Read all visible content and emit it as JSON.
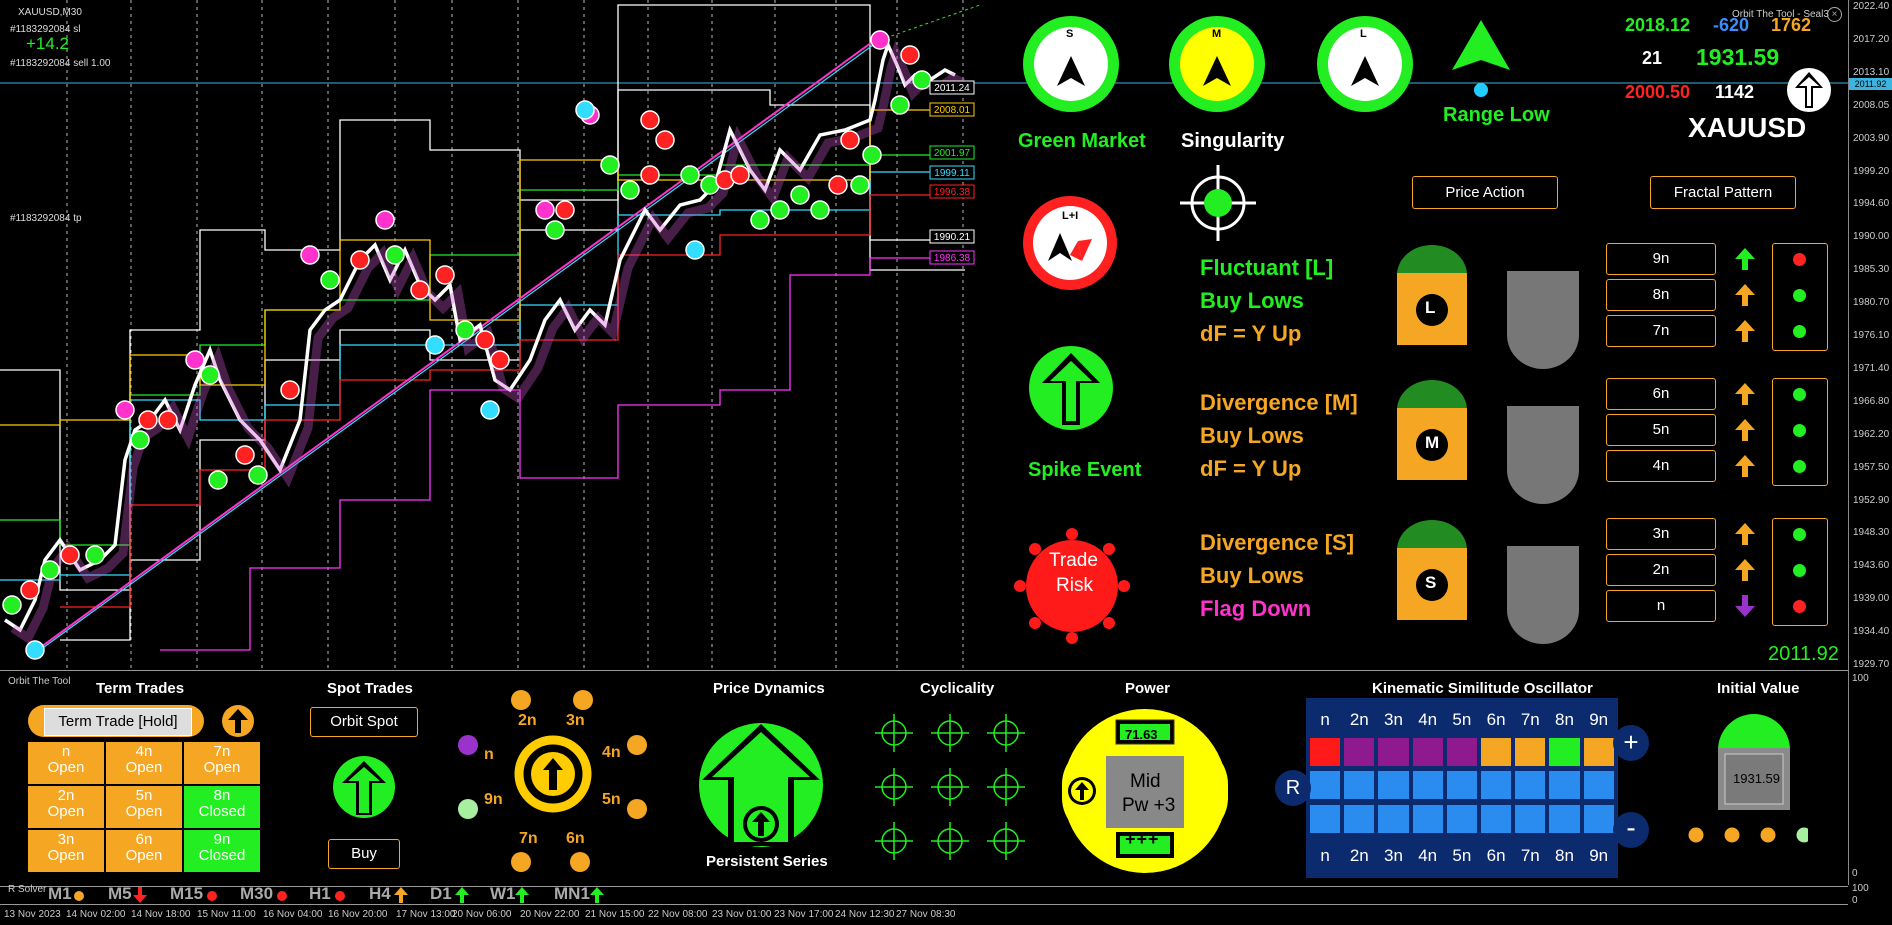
{
  "window": {
    "symbol_tf": "XAUUSD,M30",
    "app_title": "Orbit The Tool - Seal3",
    "subwindow_title": "Orbit The Tool",
    "subwindow2_title": "R Solver"
  },
  "chart": {
    "order_sl": "#1183292084 sl",
    "pnl": "+14.2",
    "order_sell": "#1183292084 sell 1.00",
    "order_tp": "#1183292084 tp",
    "price_axis": [
      "2022.40",
      "2017.20",
      "2013.10",
      "2008.05",
      "2003.90",
      "1999.20",
      "1994.60",
      "1990.00",
      "1985.30",
      "1980.70",
      "1976.10",
      "1971.40",
      "1966.80",
      "1962.20",
      "1957.50",
      "1952.90",
      "1948.30",
      "1943.60",
      "1939.00",
      "1934.40",
      "1929.70"
    ],
    "current_price_tag": "2011.92",
    "level_tags": [
      {
        "label": "2011.24",
        "color": "#ffffff"
      },
      {
        "label": "2008.01",
        "color": "#ffcc00"
      },
      {
        "label": "2001.97",
        "color": "#22ee22"
      },
      {
        "label": "1999.11",
        "color": "#33ddff"
      },
      {
        "label": "1996.38",
        "color": "#ff2222"
      },
      {
        "label": "1990.21",
        "color": "#ffffff"
      },
      {
        "label": "1986.38",
        "color": "#ff33ff"
      }
    ],
    "time_axis": [
      "13 Nov 2023",
      "14 Nov 02:00",
      "14 Nov 18:00",
      "15 Nov 11:00",
      "16 Nov 04:00",
      "16 Nov 20:00",
      "17 Nov 13:00",
      "20 Nov 06:00",
      "20 Nov 22:00",
      "21 Nov 15:00",
      "22 Nov 08:00",
      "23 Nov 01:00",
      "23 Nov 17:00",
      "24 Nov 12:30",
      "27 Nov 08:30"
    ],
    "sub_axis": [
      "100",
      "0",
      "100",
      "0"
    ]
  },
  "dashboard": {
    "compass": [
      {
        "letter": "S",
        "label": "Green Market",
        "ring": "#22ee22",
        "fill": "#ffffff"
      },
      {
        "letter": "M",
        "label": "Singularity",
        "ring": "#22ee22",
        "fill": "#ffff00"
      },
      {
        "letter": "L",
        "label": "",
        "ring": "#22ee22",
        "fill": "#ffffff"
      }
    ],
    "range_label": "Range Low",
    "lplus_letter": "L+I",
    "spike_label": "Spike Event",
    "trade_risk_1": "Trade",
    "trade_risk_2": "Risk",
    "stats": {
      "v1": "2018.12",
      "v2": "-620",
      "v3": "1762",
      "v4": "21",
      "v5": "1931.59",
      "v6": "2000.50",
      "v7": "1142"
    },
    "symbol": "XAUUSD",
    "btn_price_action": "Price Action",
    "btn_fractal": "Fractal Pattern",
    "groups": [
      {
        "l1": "Fluctuant [L]",
        "l2": "Buy Lows",
        "l3": "dF = Y Up",
        "c1": "#22ee22",
        "c2": "#22ee22",
        "c3": "#f5a623",
        "badge": "L",
        "rows": [
          {
            "n": "9n",
            "arrow": "up",
            "ac": "#22ee22",
            "dot": "#ff2222"
          },
          {
            "n": "8n",
            "arrow": "up",
            "ac": "#f5a623",
            "dot": "#22ee22"
          },
          {
            "n": "7n",
            "arrow": "up",
            "ac": "#f5a623",
            "dot": "#22ee22"
          }
        ]
      },
      {
        "l1": "Divergence [M]",
        "l2": "Buy Lows",
        "l3": "dF = Y Up",
        "c1": "#f5a623",
        "c2": "#f5a623",
        "c3": "#f5a623",
        "badge": "M",
        "rows": [
          {
            "n": "6n",
            "arrow": "up",
            "ac": "#f5a623",
            "dot": "#22ee22"
          },
          {
            "n": "5n",
            "arrow": "up",
            "ac": "#f5a623",
            "dot": "#22ee22"
          },
          {
            "n": "4n",
            "arrow": "up",
            "ac": "#f5a623",
            "dot": "#22ee22"
          }
        ]
      },
      {
        "l1": "Divergence [S]",
        "l2": "Buy Lows",
        "l3": "Flag Down",
        "c1": "#f5a623",
        "c2": "#f5a623",
        "c3": "#ff33cc",
        "badge": "S",
        "rows": [
          {
            "n": "3n",
            "arrow": "up",
            "ac": "#f5a623",
            "dot": "#22ee22"
          },
          {
            "n": "2n",
            "arrow": "up",
            "ac": "#f5a623",
            "dot": "#22ee22"
          },
          {
            "n": "n",
            "arrow": "down",
            "ac": "#9933cc",
            "dot": "#ff2222"
          }
        ]
      }
    ],
    "price_readout": "2011.92"
  },
  "bottom": {
    "term_trades": {
      "title": "Term Trades",
      "hold": "Term Trade [Hold]",
      "cells": [
        {
          "n": "n",
          "s": "Open",
          "c": "#f5a623"
        },
        {
          "n": "4n",
          "s": "Open",
          "c": "#f5a623"
        },
        {
          "n": "7n",
          "s": "Open",
          "c": "#f5a623"
        },
        {
          "n": "2n",
          "s": "Open",
          "c": "#f5a623"
        },
        {
          "n": "5n",
          "s": "Open",
          "c": "#f5a623"
        },
        {
          "n": "8n",
          "s": "Closed",
          "c": "#22ee22"
        },
        {
          "n": "3n",
          "s": "Open",
          "c": "#f5a623"
        },
        {
          "n": "6n",
          "s": "Open",
          "c": "#f5a623"
        },
        {
          "n": "9n",
          "s": "Closed",
          "c": "#22ee22"
        }
      ]
    },
    "spot": {
      "title": "Spot Trades",
      "btn": "Orbit Spot",
      "action": "Buy"
    },
    "orbit_labels": [
      "2n",
      "3n",
      "4n",
      "5n",
      "6n",
      "7n",
      "9n",
      "n"
    ],
    "dynamics": {
      "title": "Price Dynamics",
      "label": "Persistent Series"
    },
    "cyclicality": {
      "title": "Cyclicality"
    },
    "power": {
      "title": "Power",
      "value": "71.63",
      "mid": "Mid",
      "pw": "Pw +3",
      "plus": "+++"
    },
    "kso": {
      "title": "Kinematic Similitude Oscillator",
      "header": [
        "n",
        "2n",
        "3n",
        "4n",
        "5n",
        "6n",
        "7n",
        "8n",
        "9n"
      ],
      "row2": [
        "#ff1a1a",
        "#8e1a8e",
        "#8e1a8e",
        "#8e1a8e",
        "#8e1a8e",
        "#f5a623",
        "#f5a623",
        "#22ee22",
        "#f5a623"
      ],
      "plus": "+",
      "minus": "-",
      "r": "R"
    },
    "initial": {
      "title": "Initial Value",
      "value": "1931.59"
    },
    "timeframes": [
      {
        "tf": "M1",
        "sym": "dot",
        "c": "#f5a623"
      },
      {
        "tf": "M5",
        "sym": "down",
        "c": "#ff2222"
      },
      {
        "tf": "M15",
        "sym": "dot",
        "c": "#ff2222"
      },
      {
        "tf": "M30",
        "sym": "dot",
        "c": "#ff2222"
      },
      {
        "tf": "H1",
        "sym": "dot",
        "c": "#ff2222"
      },
      {
        "tf": "H4",
        "sym": "up",
        "c": "#f5a623"
      },
      {
        "tf": "D1",
        "sym": "up",
        "c": "#22ee22"
      },
      {
        "tf": "W1",
        "sym": "up",
        "c": "#22ee22"
      },
      {
        "tf": "MN1",
        "sym": "up",
        "c": "#22ee22"
      }
    ]
  }
}
